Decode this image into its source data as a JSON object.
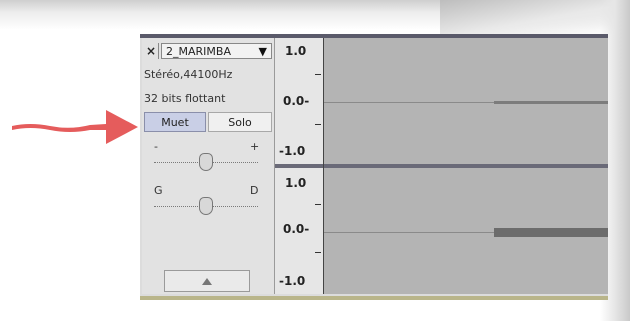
{
  "track": {
    "close_label": "×",
    "name": "2_MARIMBA",
    "dropdown_caret": "▼",
    "format": "Stéréo,44100Hz",
    "bit_depth": "32 bits flottant",
    "mute_label": "Muet",
    "solo_label": "Solo",
    "gain": {
      "min_label": "-",
      "max_label": "+",
      "level": 0.5
    },
    "pan": {
      "left_label": "G",
      "right_label": "D",
      "level": 0.5
    },
    "collapse_icon": "triangle-up-icon"
  },
  "ruler": {
    "channel1": {
      "top": "1.0",
      "mid": "0.0-",
      "bottom": "-1.0"
    },
    "channel2": {
      "top": "1.0",
      "mid": "0.0-",
      "bottom": "-1.0"
    }
  },
  "colors": {
    "mute_bg": "#c9cfe6",
    "arrow": "#e04040",
    "wave_bg": "#b4b4b4"
  }
}
